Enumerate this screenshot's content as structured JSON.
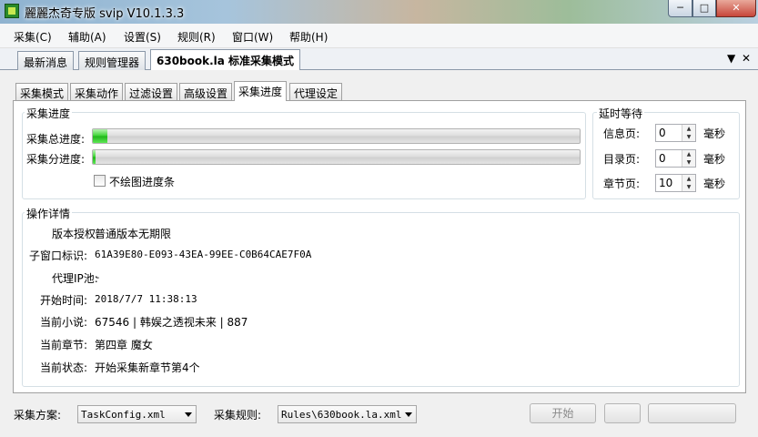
{
  "window": {
    "title": "麗麗杰奇专版 svip V10.1.3.3",
    "minimize": "─",
    "maximize": "□",
    "close": "✕"
  },
  "menu": [
    "采集(C)",
    "辅助(A)",
    "设置(S)",
    "规则(R)",
    "窗口(W)",
    "帮助(H)"
  ],
  "doc_tabs": [
    "最新消息",
    "规则管理器",
    "630book.la 标准采集模式"
  ],
  "doc_tab_controls": {
    "dropdown": "▼",
    "close": "✕"
  },
  "sub_tabs": [
    "采集模式",
    "采集动作",
    "过滤设置",
    "高级设置",
    "采集进度",
    "代理设定"
  ],
  "progress_group": {
    "title": "采集进度",
    "total_label": "采集总进度:",
    "total_value": 0.03,
    "sub_label": "采集分进度:",
    "sub_value": 0.005,
    "no_draw_label": "不绘图进度条",
    "no_draw_checked": false
  },
  "delay_group": {
    "title": "延时等待",
    "rows": [
      {
        "label": "信息页:",
        "value": "0",
        "unit": "毫秒"
      },
      {
        "label": "目录页:",
        "value": "0",
        "unit": "毫秒"
      },
      {
        "label": "章节页:",
        "value": "10",
        "unit": "毫秒"
      }
    ]
  },
  "details": {
    "title": "操作详情",
    "rows": [
      {
        "label": "版本授权:",
        "value": "普通版本无期限"
      },
      {
        "label": "子窗口标识:",
        "value": "61A39E80-E093-43EA-99EE-C0B64CAE7F0A"
      },
      {
        "label": "代理IP池:",
        "value": "-"
      },
      {
        "label": "开始时间:",
        "value": "2018/7/7 11:38:13"
      },
      {
        "label": "当前小说:",
        "value": "67546 | 韩娱之透视未来 | 887"
      },
      {
        "label": "当前章节:",
        "value": "第四章 魔女"
      },
      {
        "label": "当前状态:",
        "value": "开始采集新章节第4个"
      }
    ]
  },
  "bottom": {
    "scheme_label": "采集方案:",
    "scheme_value": "TaskConfig.xml",
    "rule_label": "采集规则:",
    "rule_value": "Rules\\630book.la.xml",
    "start_button": "开始"
  }
}
